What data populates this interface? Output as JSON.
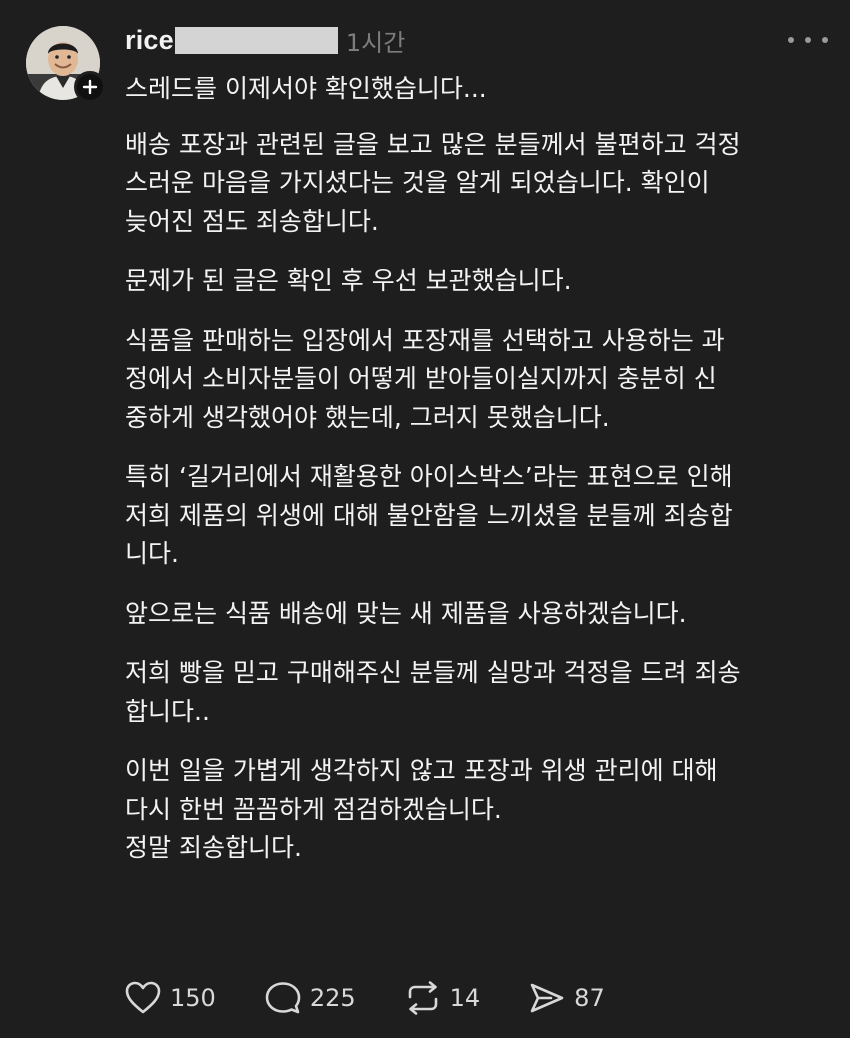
{
  "post": {
    "username": "rice",
    "timestamp": "1시간",
    "avatar_icon": "profile-photo",
    "follow_icon": "plus-icon",
    "more_icon": "more-dots-icon",
    "paragraphs": [
      "스레드를 이제서야 확인했습니다...",
      "배송 포장과 관련된 글을 보고 많은 분들께서 불편하고 걱정\n스러운 마음을 가지셨다는 것을 알게 되었습니다. 확인이\n늦어진 점도 죄송합니다.",
      "문제가 된 글은 확인 후 우선 보관했습니다.",
      "식품을 판매하는 입장에서 포장재를 선택하고 사용하는 과\n정에서 소비자분들이 어떻게 받아들이실지까지 충분히 신\n중하게 생각했어야 했는데, 그러지 못했습니다.",
      "특히 ‘길거리에서 재활용한 아이스박스’라는 표현으로 인해\n저희 제품의 위생에 대해 불안함을 느끼셨을 분들께 죄송합\n니다.",
      "앞으로는 식품 배송에 맞는 새 제품을 사용하겠습니다.",
      "저희 빵을 믿고 구매해주신 분들께 실망과 걱정을 드려 죄송\n합니다..",
      "이번 일을 가볍게 생각하지 않고 포장과 위생 관리에 대해\n다시 한번 꼼꼼하게 점검하겠습니다.\n정말 죄송합니다."
    ]
  },
  "actions": {
    "like": {
      "icon": "heart-icon",
      "count": "150"
    },
    "comment": {
      "icon": "comment-icon",
      "count": "225"
    },
    "repost": {
      "icon": "repost-icon",
      "count": "14"
    },
    "share": {
      "icon": "send-icon",
      "count": "87"
    }
  },
  "colors": {
    "background": "#1e1e1e",
    "text": "#f3f3f3",
    "muted": "#7d7d7d",
    "redaction": "#d4d4d4"
  }
}
